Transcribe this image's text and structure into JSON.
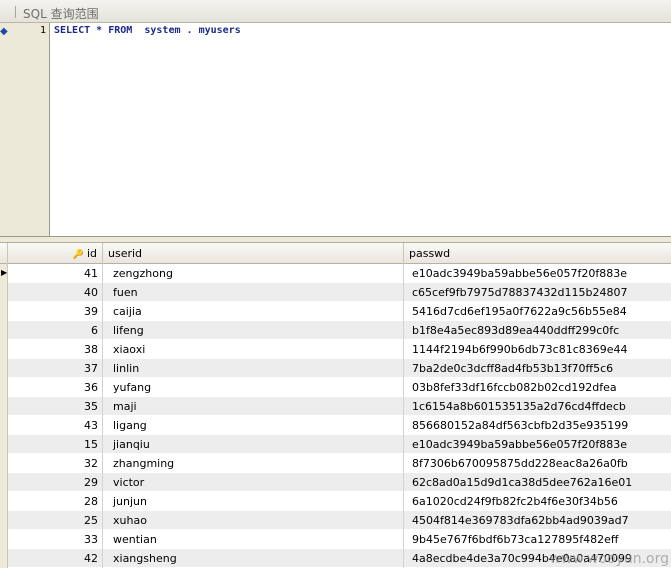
{
  "panel": {
    "title": "SQL 查询范围"
  },
  "editor": {
    "line_number": "1",
    "tokens": {
      "select": "SELECT",
      "star": "*",
      "from": "FROM",
      "schema": "system",
      "dot": ".",
      "table": "myusers"
    }
  },
  "grid": {
    "columns": [
      "id",
      "userid",
      "passwd"
    ],
    "rows": [
      {
        "id": "41",
        "userid": "zengzhong",
        "passwd": "e10adc3949ba59abbe56e057f20f883e"
      },
      {
        "id": "40",
        "userid": "fuen",
        "passwd": "c65cef9fb7975d78837432d115b24807"
      },
      {
        "id": "39",
        "userid": "caijia",
        "passwd": "5416d7cd6ef195a0f7622a9c56b55e84"
      },
      {
        "id": "6",
        "userid": "lifeng",
        "passwd": "b1f8e4a5ec893d89ea440ddff299c0fc"
      },
      {
        "id": "38",
        "userid": "xiaoxi",
        "passwd": "1144f2194b6f990b6db73c81c8369e44"
      },
      {
        "id": "37",
        "userid": "linlin",
        "passwd": "7ba2de0c3dcff8ad4fb53b13f70ff5c6"
      },
      {
        "id": "36",
        "userid": "yufang",
        "passwd": "03b8fef33df16fccb082b02cd192dfea"
      },
      {
        "id": "35",
        "userid": "maji",
        "passwd": "1c6154a8b601535135a2d76cd4ffdecb"
      },
      {
        "id": "43",
        "userid": "ligang",
        "passwd": "856680152a84df563cbfb2d35e935199"
      },
      {
        "id": "15",
        "userid": "jianqiu",
        "passwd": "e10adc3949ba59abbe56e057f20f883e"
      },
      {
        "id": "32",
        "userid": "zhangming",
        "passwd": "8f7306b670095875dd228eac8a26a0fb"
      },
      {
        "id": "29",
        "userid": "victor",
        "passwd": "62c8ad0a15d9d1ca38d5dee762a16e01"
      },
      {
        "id": "28",
        "userid": "junjun",
        "passwd": "6a1020cd24f9fb82fc2b4f6e30f34b56"
      },
      {
        "id": "25",
        "userid": "xuhao",
        "passwd": "4504f814e369783dfa62bb4ad9039ad7"
      },
      {
        "id": "33",
        "userid": "wentian",
        "passwd": "9b45e767f6bdf6b73ca127895f482eff"
      },
      {
        "id": "42",
        "userid": "xiangsheng",
        "passwd": "4a8ecdbe4de3a70c994b4e0a0a470099"
      }
    ]
  },
  "watermark": "www.wooyun.org"
}
